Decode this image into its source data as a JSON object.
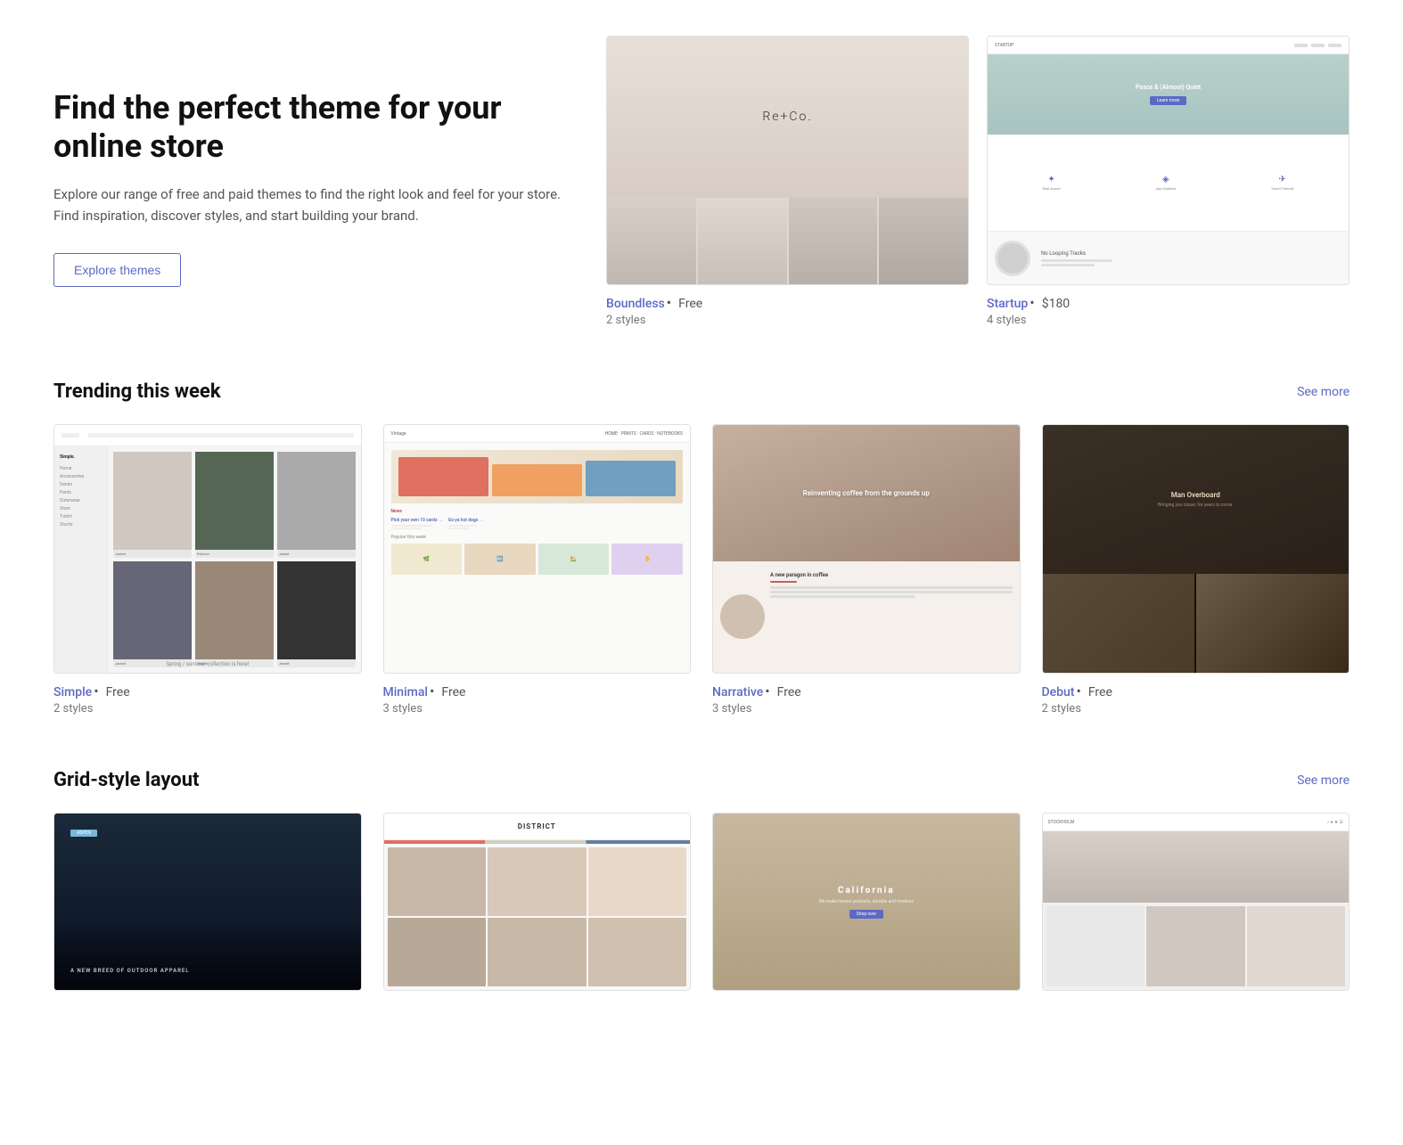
{
  "hero": {
    "title": "Find the perfect theme for your online store",
    "description": "Explore our range of free and paid themes to find the right look and feel for your store. Find inspiration, discover styles, and start building your brand.",
    "explore_button": "Explore themes",
    "themes": [
      {
        "name": "Boundless",
        "price": "Free",
        "styles": "2 styles",
        "type": "boundless"
      },
      {
        "name": "Startup",
        "price": "$180",
        "styles": "4 styles",
        "type": "startup"
      }
    ]
  },
  "trending": {
    "title": "Trending this week",
    "see_more": "See more",
    "themes": [
      {
        "name": "Simple",
        "price": "Free",
        "styles": "2 styles",
        "type": "simple",
        "tagline": "Spring / summer collection is here!"
      },
      {
        "name": "Minimal",
        "price": "Free",
        "styles": "3 styles",
        "type": "minimal"
      },
      {
        "name": "Narrative",
        "price": "Free",
        "styles": "3 styles",
        "type": "narrative",
        "tagline": "Reinventing coffee from the grounds up"
      },
      {
        "name": "Debut",
        "price": "Free",
        "styles": "2 styles",
        "type": "debut",
        "tagline": "Man Overboard"
      }
    ]
  },
  "grid_layout": {
    "title": "Grid-style layout",
    "see_more": "See more",
    "themes": [
      {
        "name": "Aspen",
        "tagline": "A NEW BREED OF OUTDOOR APPAREL",
        "type": "aspen"
      },
      {
        "name": "District",
        "type": "district"
      },
      {
        "name": "California",
        "tagline": "We make honest products, durable and timeless",
        "type": "california"
      },
      {
        "name": "Stockholm",
        "type": "stockholm"
      }
    ]
  }
}
